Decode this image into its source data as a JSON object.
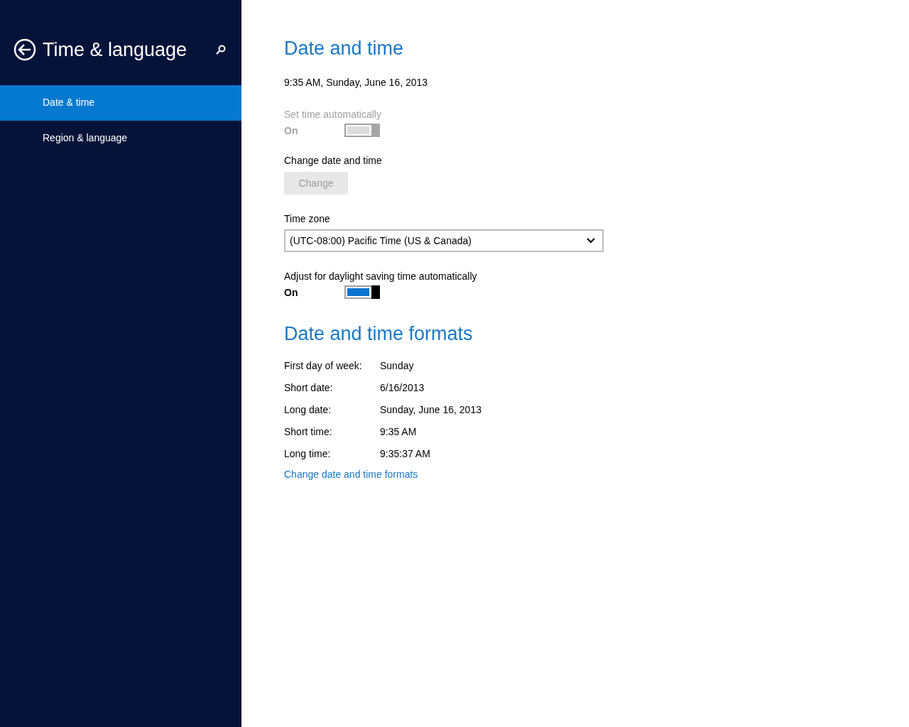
{
  "sidebar": {
    "title": "Time & language",
    "items": [
      {
        "label": "Date & time",
        "selected": true
      },
      {
        "label": "Region & language",
        "selected": false
      }
    ]
  },
  "date_time": {
    "heading": "Date and time",
    "current": "9:35 AM, Sunday, June 16, 2013",
    "settings": [
      {
        "kind": "toggle",
        "label": "Set time automatically",
        "state_text": "On",
        "on": true,
        "disabled": true
      },
      {
        "kind": "button",
        "label": "Change date and time",
        "button": "Change",
        "disabled": true
      },
      {
        "kind": "dropdown",
        "label": "Time zone",
        "value": "(UTC-08:00) Pacific Time (US & Canada)"
      },
      {
        "kind": "toggle",
        "label": "Adjust for daylight saving time automatically",
        "state_text": "On",
        "on": true,
        "disabled": false
      }
    ]
  },
  "formats": {
    "heading": "Date and time formats",
    "rows": [
      {
        "label": "First day of week:",
        "value": "Sunday"
      },
      {
        "label": "Short date:",
        "value": "6/16/2013"
      },
      {
        "label": "Long date:",
        "value": "Sunday, June 16, 2013"
      },
      {
        "label": "Short time:",
        "value": "9:35 AM"
      },
      {
        "label": "Long time:",
        "value": "9:35:37 AM"
      }
    ],
    "link": "Change date and time formats"
  }
}
